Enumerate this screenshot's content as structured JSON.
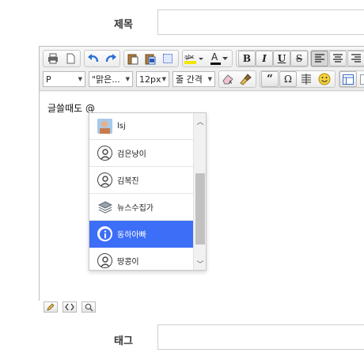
{
  "form": {
    "title_label": "제목",
    "title_value": "",
    "tag_label": "태그",
    "tag_value": ""
  },
  "toolbar": {
    "format_select": "P",
    "font_select": "\"맑은...",
    "size_select": "12px",
    "line_height_select": "줄 간격",
    "bold": "B",
    "italic": "I",
    "underline": "U",
    "strike": "S",
    "quote": "“",
    "omega": "Ω",
    "font_color": "A"
  },
  "editor": {
    "content_text": "글쓸때도 @"
  },
  "mention_dropdown": {
    "items": [
      {
        "label": "lsj",
        "icon": "photo-avatar-icon"
      },
      {
        "label": "검은냥이",
        "icon": "user-avatar-icon"
      },
      {
        "label": "김복진",
        "icon": "user-avatar-icon"
      },
      {
        "label": "뉴스수집가",
        "icon": "layers-icon"
      },
      {
        "label": "동하아빠",
        "icon": "info-icon",
        "selected": true
      },
      {
        "label": "땅콩이",
        "icon": "user-avatar-icon"
      }
    ]
  },
  "colors": {
    "selected_item": "#3d6ef7",
    "toolbar_bg": "#ececec",
    "border": "#bdbdbd"
  }
}
